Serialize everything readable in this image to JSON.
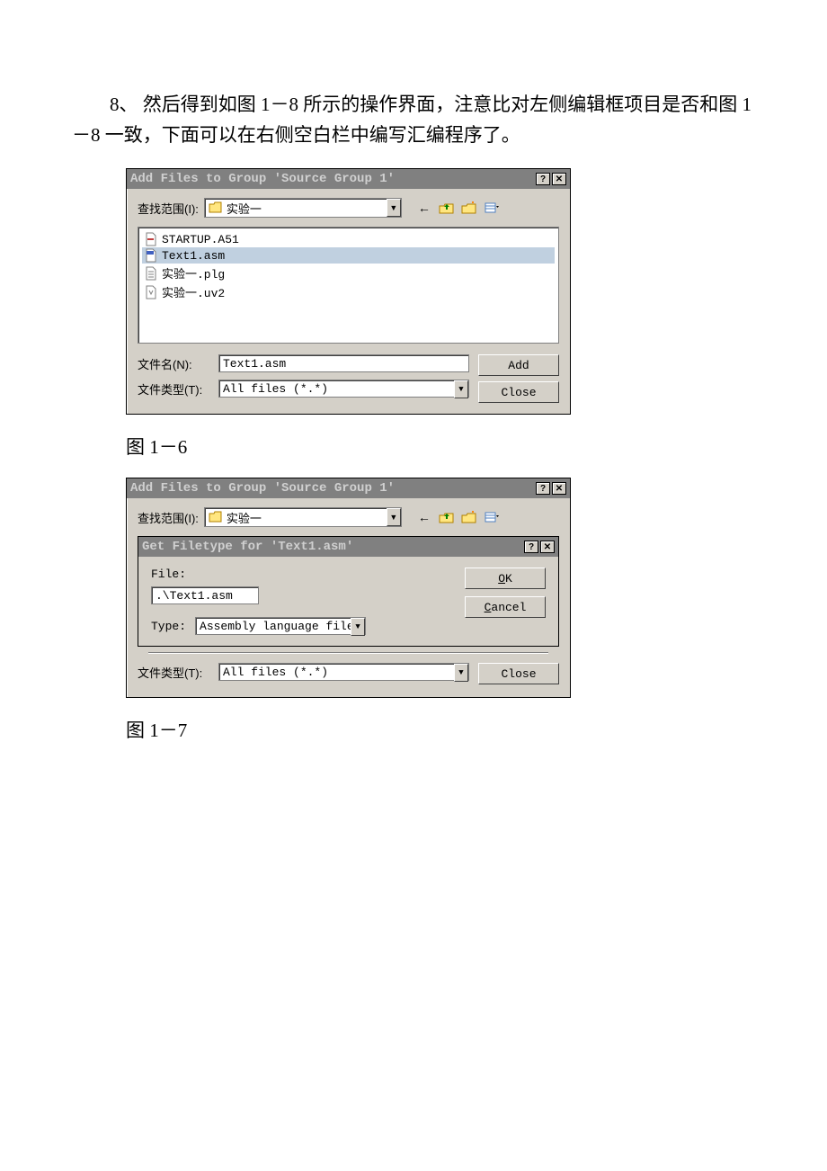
{
  "paragraph": "8、 然后得到如图 1－8 所示的操作界面，注意比对左侧编辑框项目是否和图 1－8 一致，下面可以在右侧空白栏中编写汇编程序了。",
  "captions": {
    "fig1_6": "图 1－6",
    "fig1_7": "图 1－7"
  },
  "dialog1": {
    "title": "Add Files to Group 'Source Group 1'",
    "lookin_label": "查找范围(I):",
    "lookin_value": "实验一",
    "files": [
      {
        "icon": "a51",
        "name": "STARTUP.A51"
      },
      {
        "icon": "asm",
        "name": "Text1.asm",
        "selected": true
      },
      {
        "icon": "plg",
        "name": "实验一.plg"
      },
      {
        "icon": "uv2",
        "name": "实验一.uv2"
      }
    ],
    "filename_label": "文件名(N):",
    "filename_value": "Text1.asm",
    "filetype_label": "文件类型(T):",
    "filetype_value": "All files (*.*)",
    "btn_add": "Add",
    "btn_close": "Close"
  },
  "dialog2": {
    "title": "Add Files to Group 'Source Group 1'",
    "lookin_label": "查找范围(I):",
    "lookin_value": "实验一",
    "inner": {
      "title": "Get Filetype for 'Text1.asm'",
      "file_label": "File:",
      "file_value": ".\\Text1.asm",
      "type_label": "Type:",
      "type_value": "Assembly language file",
      "btn_ok": "OK",
      "btn_cancel": "Cancel"
    },
    "filetype_label": "文件类型(T):",
    "filetype_value": "All files (*.*)",
    "btn_close": "Close"
  }
}
